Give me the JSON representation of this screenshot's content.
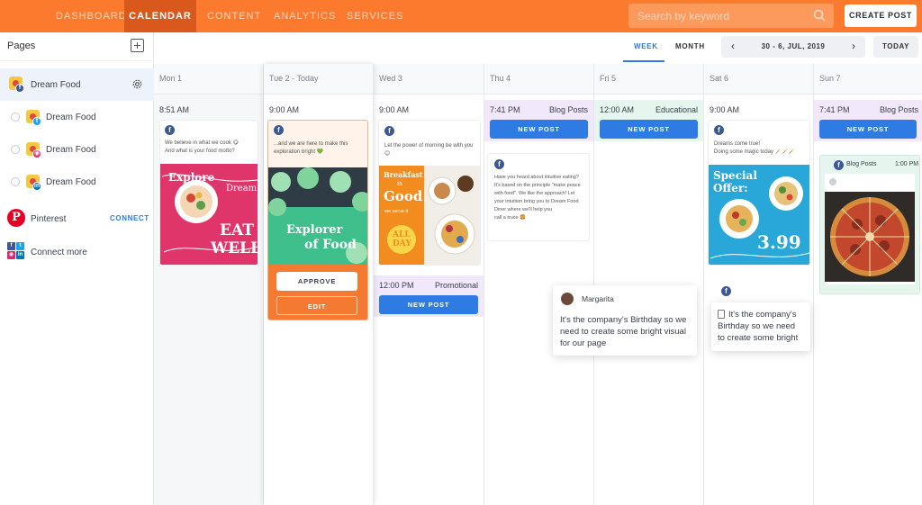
{
  "nav": {
    "tabs": [
      "DASHBOARD",
      "CALENDAR",
      "CONTENT",
      "ANALYTICS",
      "SERVICES"
    ],
    "active": "CALENDAR",
    "search_placeholder": "Search by keyword",
    "create_label": "CREATE POST",
    "accent": "#fb7a2e"
  },
  "sidebar": {
    "title": "Pages",
    "pages": [
      {
        "label": "Dream Food",
        "network": "facebook",
        "selected": true
      },
      {
        "label": "Dream Food",
        "network": "twitter",
        "selected": false
      },
      {
        "label": "Dream Food",
        "network": "instagram",
        "selected": false
      },
      {
        "label": "Dream Food",
        "network": "linkedin",
        "selected": false
      }
    ],
    "pinterest": {
      "label": "Pinterest",
      "action": "CONNECT"
    },
    "connect_more": "Connect more"
  },
  "controls": {
    "views": [
      "WEEK",
      "MONTH"
    ],
    "active_view": "WEEK",
    "range": "30 - 6, JUL, 2019",
    "today": "TODAY",
    "prev": "‹",
    "next": "›"
  },
  "days": [
    "Mon 1",
    "Tue 2 - Today",
    "Wed 3",
    "Thu 4",
    "Fri 5",
    "Sat 6",
    "Sun 7"
  ],
  "slots": {
    "mon": {
      "time": "8:51 AM",
      "text1": "We believe in what we cook 😋",
      "text2": "And what is your food motto?",
      "img_top": "Explore",
      "img_mid": "Dream.",
      "img_b1": "EAT",
      "img_b2": "WELL."
    },
    "tue": {
      "time": "9:00 AM",
      "text1": "...and we are here to make this",
      "text2": "exploration bright 💚",
      "img_top": "Explorer",
      "img_b": "of Food",
      "approve": "APPROVE",
      "edit": "EDIT"
    },
    "wed": {
      "time": "9:00 AM",
      "text1": "Let the power of morning be with you 😊",
      "img_t1": "Breakfast",
      "img_t2": "is",
      "img_t3": "Good",
      "img_t4": "we serve it",
      "img_t5": "ALL",
      "img_t6": "DAY",
      "time2": "12:00 PM",
      "tag2": "Promotional",
      "new_post": "NEW POST"
    },
    "thu": {
      "time": "7:41 PM",
      "tag": "Blog Posts",
      "new_post": "NEW POST",
      "text1": "Have you heard about intuitive eating?",
      "text2": "It's based on the principle \"make peace",
      "text3": "with food\". We like the approach! Let",
      "text4": "your intuition bring you to Dream Food",
      "text5": "Diner where we'll help you",
      "text6": "call a truce 🍔"
    },
    "fri": {
      "time": "12:00 AM",
      "tag": "Educational",
      "new_post": "NEW POST"
    },
    "sat": {
      "time": "9:00 AM",
      "text1": "Dreams come true!",
      "text2": "Doing some magic today 🪄🪄🪄",
      "img_t1": "Special",
      "img_t2": "Offer:",
      "img_price": "3.99"
    },
    "sun": {
      "time": "7:41 PM",
      "tag": "Blog Posts",
      "new_post": "NEW POST",
      "mini_tag": "Blog Posts",
      "mini_time": "1:00 PM"
    }
  },
  "comments": {
    "c1": {
      "author": "Margarita",
      "line1": "It's the company's Birthday so we",
      "line2": "need to create some bright visual",
      "line3": "for our page"
    },
    "c2": {
      "line1": "It's the company's",
      "line2": "Birthday so we need",
      "line3": "to create some bright"
    }
  }
}
